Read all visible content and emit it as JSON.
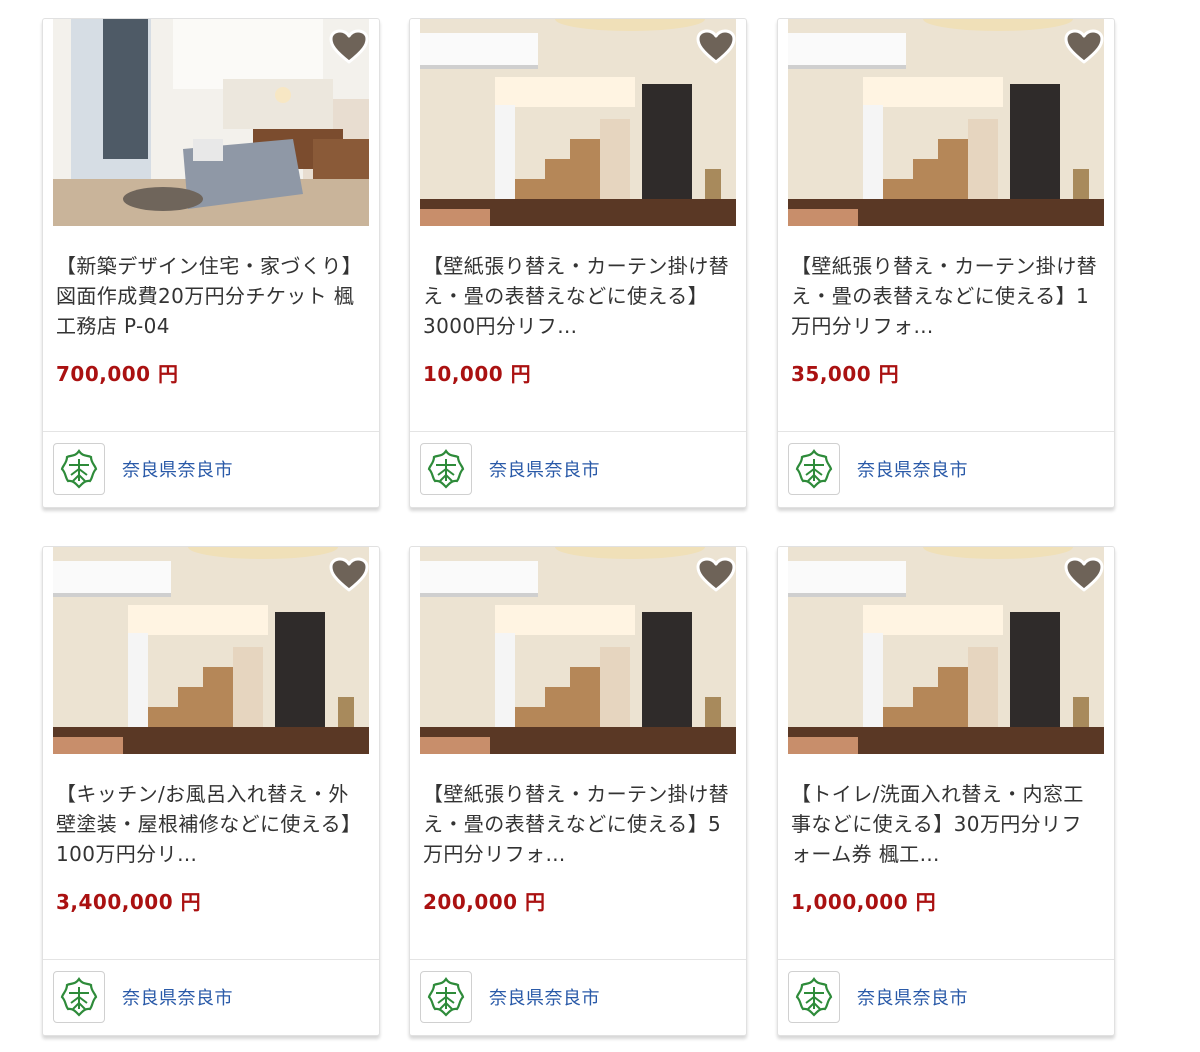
{
  "products": [
    {
      "title": "【新築デザイン住宅・家づくり】図面作成費20万円分チケット 楓工務店 P-04",
      "price": "700,000 円",
      "municipality": "奈良県奈良市",
      "image": "living-room-photo"
    },
    {
      "title": "【壁紙張り替え・カーテン掛け替え・畳の表替えなどに使える】3000円分リフ…",
      "price": "10,000 円",
      "municipality": "奈良県奈良市",
      "image": "stair-shelf-room-photo"
    },
    {
      "title": "【壁紙張り替え・カーテン掛け替え・畳の表替えなどに使える】1万円分リフォ…",
      "price": "35,000 円",
      "municipality": "奈良県奈良市",
      "image": "stair-shelf-room-photo"
    },
    {
      "title": "【キッチン/お風呂入れ替え・外壁塗装・屋根補修などに使える】100万円分リ…",
      "price": "3,400,000 円",
      "municipality": "奈良県奈良市",
      "image": "stair-shelf-room-photo"
    },
    {
      "title": "【壁紙張り替え・カーテン掛け替え・畳の表替えなどに使える】5万円分リフォ…",
      "price": "200,000 円",
      "municipality": "奈良県奈良市",
      "image": "stair-shelf-room-photo"
    },
    {
      "title": "【トイレ/洗面入れ替え・内窓工事などに使える】30万円分リフォーム券 楓工…",
      "price": "1,000,000 円",
      "municipality": "奈良県奈良市",
      "image": "stair-shelf-room-photo"
    }
  ],
  "icons": {
    "favorite": "heart-icon",
    "municipality_logo": "nara-city-emblem-icon"
  },
  "colors": {
    "price": "#aa1111",
    "municipality_link": "#2a5aa8",
    "emblem": "#2e8b3a",
    "heart_fill": "#6e6358"
  }
}
